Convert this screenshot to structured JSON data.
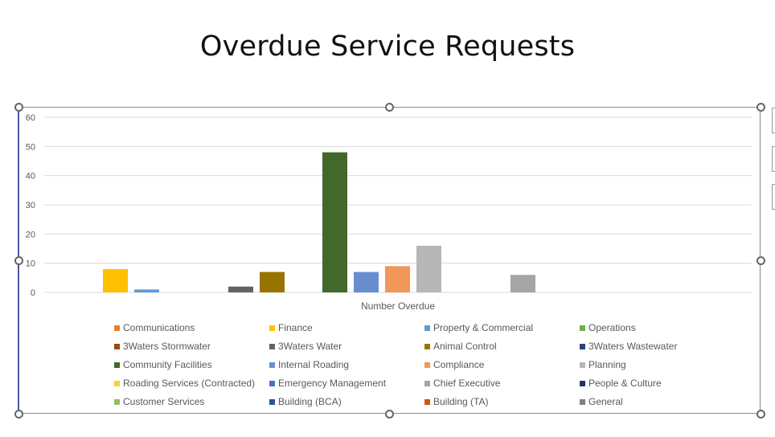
{
  "chart_data": {
    "type": "bar",
    "title": "Overdue Service Requests",
    "categories": [
      "Number Overdue"
    ],
    "xlabel": "",
    "ylabel": "",
    "ylim": [
      0,
      60
    ],
    "yticks": [
      "0",
      "10",
      "20",
      "30",
      "40",
      "50",
      "60"
    ],
    "grid": true,
    "legend_position": "bottom",
    "series": [
      {
        "name": "Communications",
        "values": [
          0
        ],
        "color": "#ED7D31"
      },
      {
        "name": "Finance",
        "values": [
          8
        ],
        "color": "#FFC000"
      },
      {
        "name": "Property & Commercial",
        "values": [
          1
        ],
        "color": "#5B9BD5"
      },
      {
        "name": "Operations",
        "values": [
          0
        ],
        "color": "#70AD47"
      },
      {
        "name": "3Waters Stormwater",
        "values": [
          0
        ],
        "color": "#9E480E"
      },
      {
        "name": "3Waters Water",
        "values": [
          2
        ],
        "color": "#636363"
      },
      {
        "name": "Animal Control",
        "values": [
          7
        ],
        "color": "#997300"
      },
      {
        "name": "3Waters Wastewater",
        "values": [
          0
        ],
        "color": "#264478"
      },
      {
        "name": "Community Facilities",
        "values": [
          48
        ],
        "color": "#43682B"
      },
      {
        "name": "Internal Roading",
        "values": [
          7
        ],
        "color": "#698ED0"
      },
      {
        "name": "Compliance",
        "values": [
          9
        ],
        "color": "#F1975A"
      },
      {
        "name": "Planning",
        "values": [
          16
        ],
        "color": "#B7B7B7"
      },
      {
        "name": "Roading Services (Contracted)",
        "values": [
          0
        ],
        "color": "#FFCD33"
      },
      {
        "name": "Emergency Management",
        "values": [
          0
        ],
        "color": "#4472C4"
      },
      {
        "name": "Chief Executive",
        "values": [
          6
        ],
        "color": "#A5A5A5"
      },
      {
        "name": "People & Culture",
        "values": [
          0
        ],
        "color": "#203864"
      },
      {
        "name": "Customer Services",
        "values": [
          0
        ],
        "color": "#8CC168"
      },
      {
        "name": "Building (BCA)",
        "values": [
          0
        ],
        "color": "#2F5597"
      },
      {
        "name": "Building (TA)",
        "values": [
          0
        ],
        "color": "#C55A11"
      },
      {
        "name": "General",
        "values": [
          0
        ],
        "color": "#7F7F7F"
      }
    ]
  },
  "page": {
    "title": "Overdue Service Requests"
  }
}
